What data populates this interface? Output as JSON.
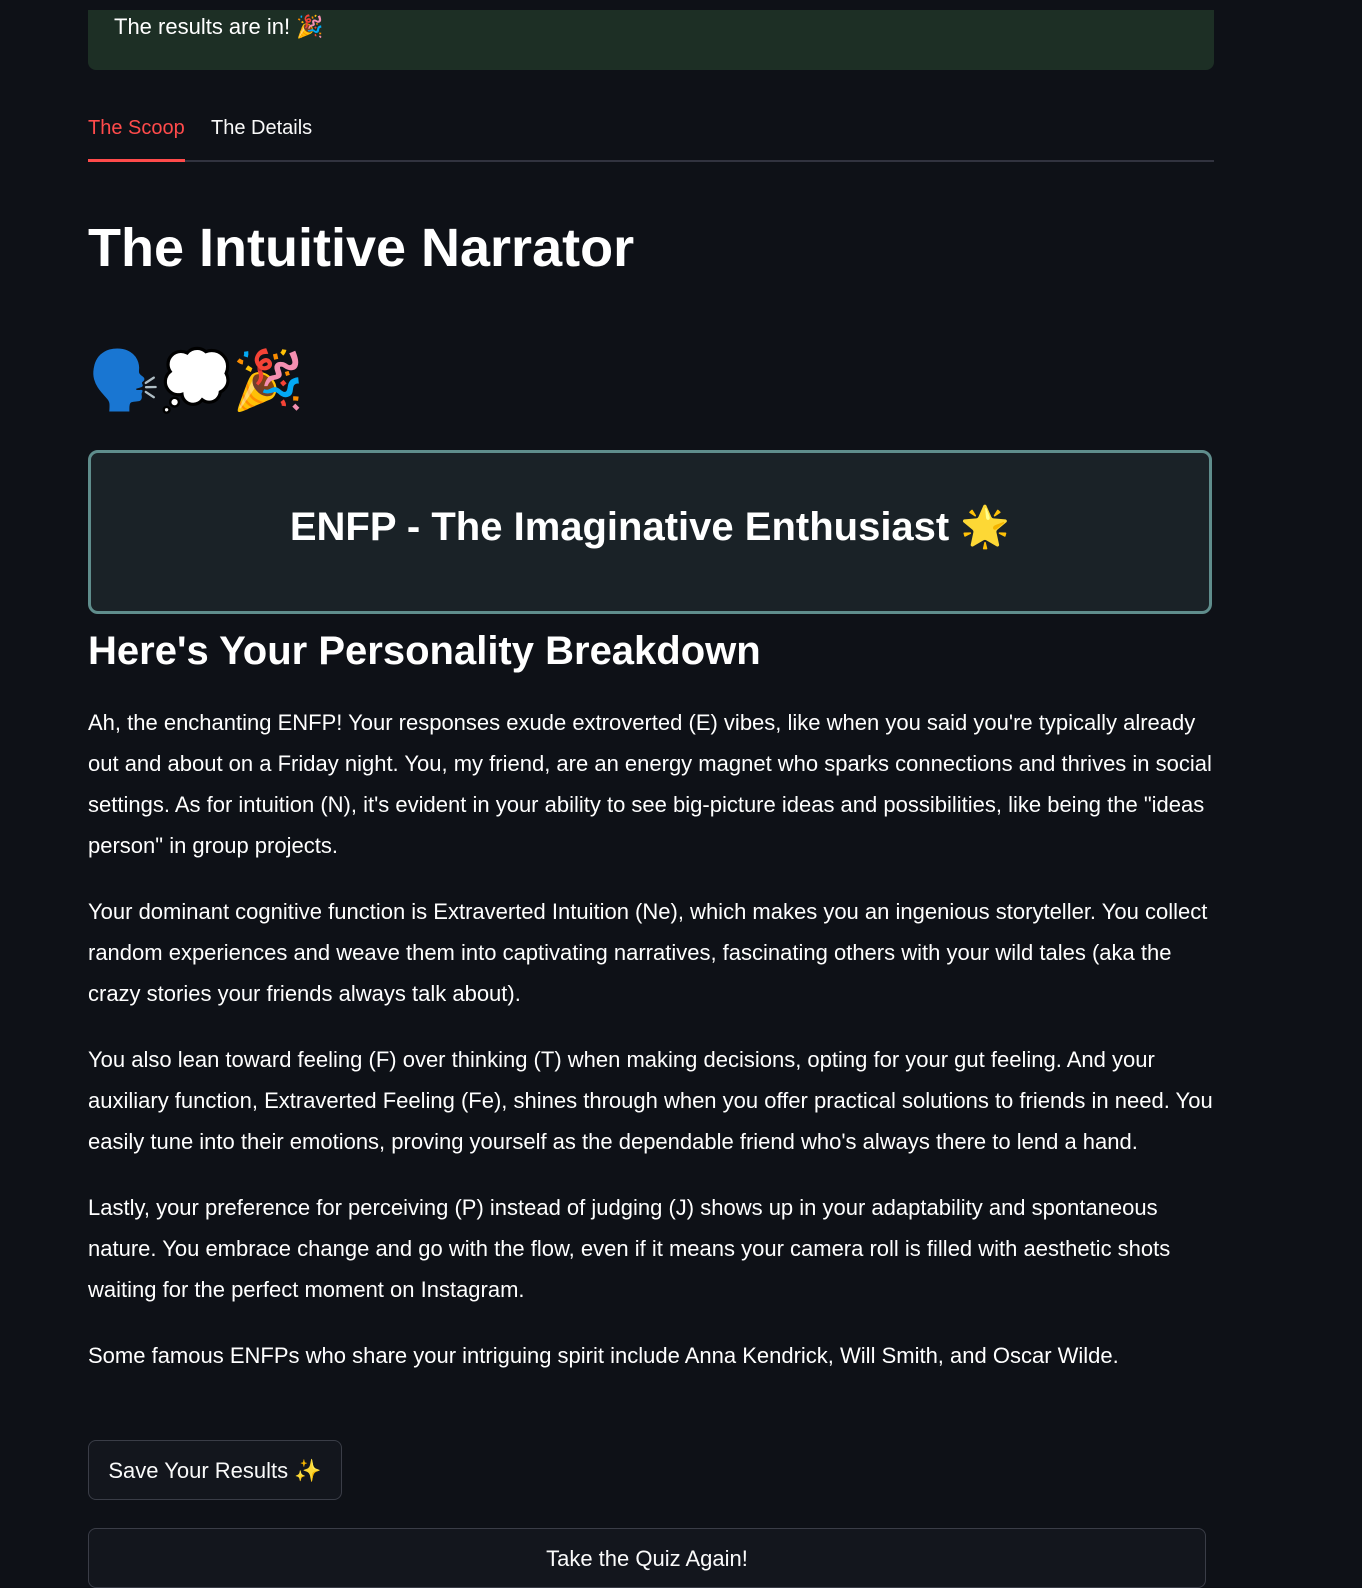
{
  "banner": {
    "text": "The results are in! 🎉"
  },
  "tabs": [
    {
      "label": "The Scoop",
      "active": true
    },
    {
      "label": "The Details",
      "active": false
    }
  ],
  "result": {
    "title": "The Intuitive Narrator",
    "emojis": "🗣️💭🎉",
    "type_label": "ENFP - The Imaginative Enthusiast 🌟"
  },
  "breakdown": {
    "heading": "Here's Your Personality Breakdown",
    "paragraphs": [
      "Ah, the enchanting ENFP! Your responses exude extroverted (E) vibes, like when you said you're typically already out and about on a Friday night. You, my friend, are an energy magnet who sparks connections and thrives in social settings. As for intuition (N), it's evident in your ability to see big-picture ideas and possibilities, like being the \"ideas person\" in group projects.",
      "Your dominant cognitive function is Extraverted Intuition (Ne), which makes you an ingenious storyteller. You collect random experiences and weave them into captivating narratives, fascinating others with your wild tales (aka the crazy stories your friends always talk about).",
      "You also lean toward feeling (F) over thinking (T) when making decisions, opting for your gut feeling. And your auxiliary function, Extraverted Feeling (Fe), shines through when you offer practical solutions to friends in need. You easily tune into their emotions, proving yourself as the dependable friend who's always there to lend a hand.",
      "Lastly, your preference for perceiving (P) instead of judging (J) shows up in your adaptability and spontaneous nature. You embrace change and go with the flow, even if it means your camera roll is filled with aesthetic shots waiting for the perfect moment on Instagram.",
      "Some famous ENFPs who share your intriguing spirit include Anna Kendrick, Will Smith, and Oscar Wilde."
    ]
  },
  "buttons": {
    "save_label": "Save Your Results ✨",
    "retake_label": "Take the Quiz Again!"
  },
  "colors": {
    "background": "#0e1117",
    "accent": "#ff4b4b",
    "banner_bg": "#1d2f25",
    "card_border": "#5f8d8c"
  }
}
